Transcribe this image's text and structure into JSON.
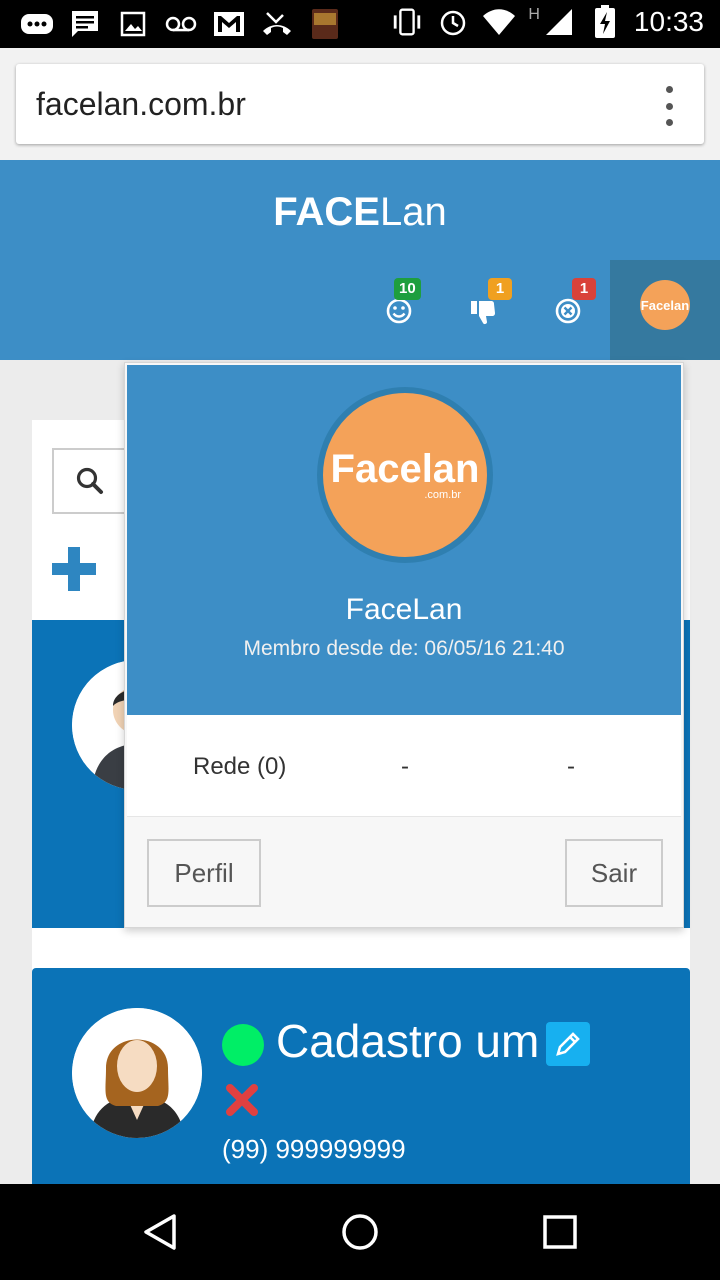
{
  "status_bar": {
    "time": "10:33",
    "network_type": "H",
    "left_icons": [
      "chat-icon",
      "message-icon",
      "image-icon",
      "voicemail-icon",
      "gmail-icon",
      "missed-call-icon",
      "book-app-icon"
    ],
    "right_icons": [
      "vibrate-icon",
      "alarm-icon",
      "wifi-icon",
      "signal-icon",
      "battery-charging-icon"
    ]
  },
  "browser": {
    "url": "facelan.com.br"
  },
  "header": {
    "brand_bold": "FACE",
    "brand_light": "Lan",
    "badges": {
      "smile_count": "10",
      "thumbs_down_count": "1",
      "close_count": "1"
    },
    "badge_colors": {
      "smile": "#1e9e3e",
      "thumbs_down": "#f0a020",
      "close": "#d9423a"
    },
    "avatar_label": "Facelan"
  },
  "dropdown": {
    "avatar_logo": "Facelan",
    "avatar_logo_sub": ".com.br",
    "name": "FaceLan",
    "member_since": "Membro desde de: 06/05/16 21:40",
    "stats": [
      "Rede (0)",
      "-",
      "-"
    ],
    "profile_button": "Perfil",
    "logout_button": "Sair"
  },
  "cards": [
    {
      "name": "Cadastro um",
      "phone": "(99) 999999999",
      "status_color": "#00ee66"
    }
  ],
  "colors": {
    "header_blue": "#3d8ec6",
    "card_blue": "#0b73b7",
    "accent_orange": "#f4a259"
  }
}
